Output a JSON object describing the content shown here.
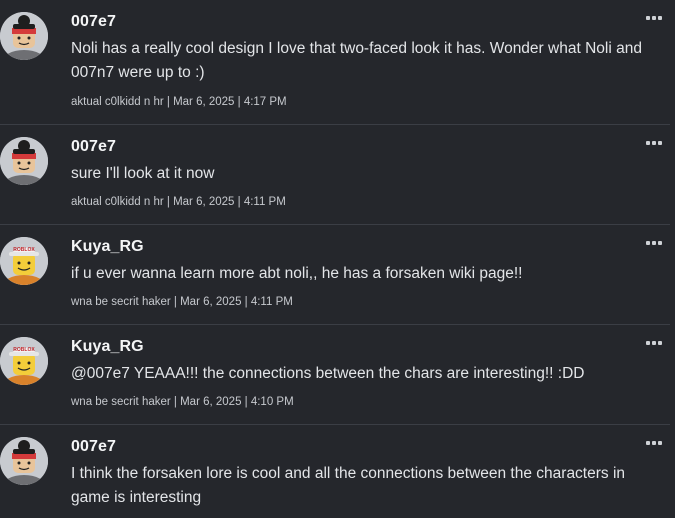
{
  "comments": [
    {
      "username": "007e7",
      "avatar_icon": "007-avatar-icon",
      "body": "Noli has a really cool design I love that two-faced look it has. Wonder what Noli and 007n7 were up to :)",
      "meta": "aktual c0lkidd n hr | Mar 6, 2025 | 4:17 PM",
      "more_icon": "more-options-icon"
    },
    {
      "username": "007e7",
      "avatar_icon": "007-avatar-icon",
      "body": "sure I'll look at it now",
      "meta": "aktual c0lkidd n hr | Mar 6, 2025 | 4:11 PM",
      "more_icon": "more-options-icon"
    },
    {
      "username": "Kuya_RG",
      "avatar_icon": "roblox-cap-avatar-icon",
      "body": "if u ever wanna learn more abt noli,, he has a forsaken wiki page!!",
      "meta": "wna be secrit haker | Mar 6, 2025 | 4:11 PM",
      "more_icon": "more-options-icon"
    },
    {
      "username": "Kuya_RG",
      "avatar_icon": "roblox-cap-avatar-icon",
      "body": "@007e7 YEAAA!!! the connections between the chars are interesting!! :DD",
      "meta": "wna be secrit haker | Mar 6, 2025 | 4:10 PM",
      "more_icon": "more-options-icon"
    },
    {
      "username": "007e7",
      "avatar_icon": "007-avatar-icon",
      "body": "I think the forsaken lore is cool and all the connections between the characters in game is interesting",
      "meta": "",
      "more_icon": "more-options-icon"
    }
  ],
  "colors": {
    "background": "#25272c",
    "divider": "#3b3e45",
    "text": "#e3e5e8",
    "meta": "#c6c9ce"
  }
}
